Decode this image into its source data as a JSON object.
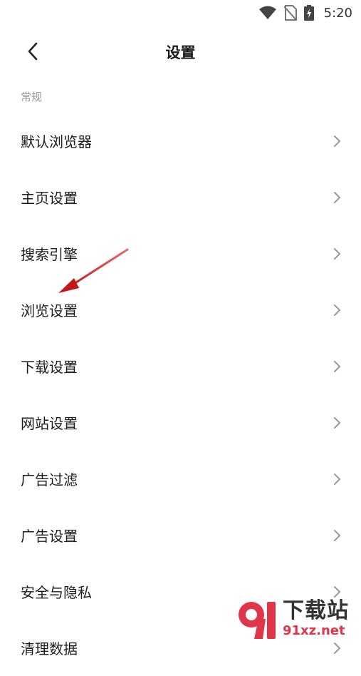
{
  "status_bar": {
    "time": "5:20"
  },
  "header": {
    "title": "设置"
  },
  "section": {
    "label": "常规"
  },
  "menu": {
    "items": [
      {
        "label": "默认浏览器"
      },
      {
        "label": "主页设置"
      },
      {
        "label": "搜索引擎"
      },
      {
        "label": "浏览设置"
      },
      {
        "label": "下载设置"
      },
      {
        "label": "网站设置"
      },
      {
        "label": "广告过滤"
      },
      {
        "label": "广告设置"
      },
      {
        "label": "安全与隐私"
      },
      {
        "label": "清理数据"
      }
    ]
  },
  "annotation": {
    "arrow_color": "#d42a2a",
    "points_to": "浏览设置"
  },
  "watermark": {
    "logo_text": "91",
    "text": "下载站",
    "url": "91xz.net"
  },
  "colors": {
    "accent_red": "#e0364a",
    "text_primary": "#1e1e1e",
    "text_secondary": "#9a9a9a"
  }
}
